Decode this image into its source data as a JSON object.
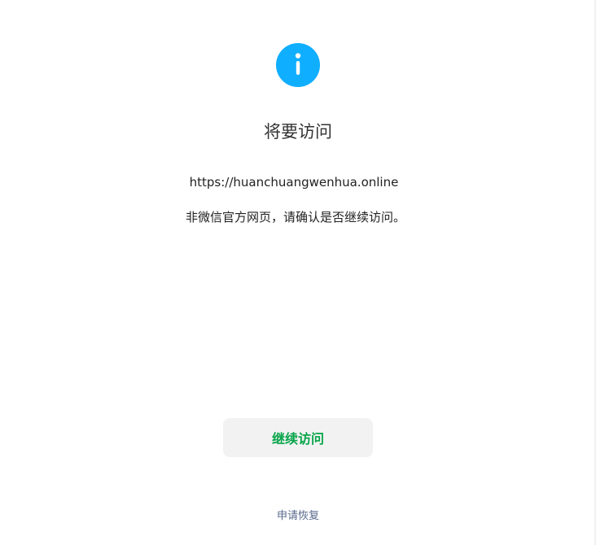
{
  "icon": {
    "name": "info-icon",
    "color": "#10aeff"
  },
  "title": "将要访问",
  "url": "https://huanchuangwenhua.online",
  "notice": "非微信官方网页，请确认是否继续访问。",
  "continue_button": {
    "label": "继续访问",
    "color": "#07a54a"
  },
  "appeal_link": {
    "label": "申请恢复",
    "color": "#586a8c"
  }
}
